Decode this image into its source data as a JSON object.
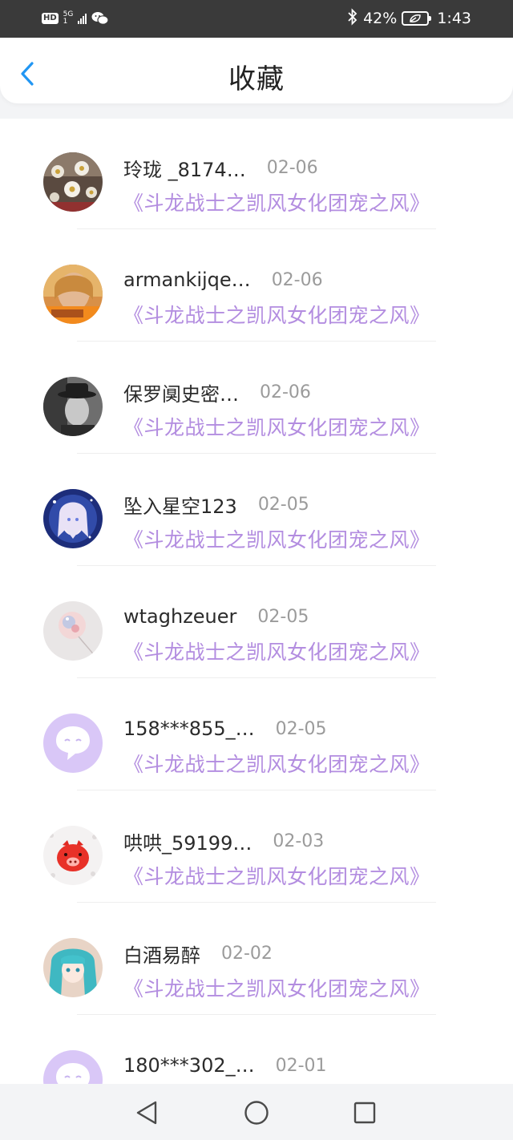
{
  "status_bar": {
    "hd": "HD",
    "network": "5G",
    "sim": "1",
    "battery_percent": "42%",
    "time": "1:43"
  },
  "header": {
    "title": "收藏"
  },
  "favorites": [
    {
      "user": "玲珑 _8174…",
      "date": "02-06",
      "work": "《斗龙战士之凯风女化团宠之风》",
      "avatar": "flowers"
    },
    {
      "user": "armankijqe…",
      "date": "02-06",
      "work": "《斗龙战士之凯风女化团宠之风》",
      "avatar": "girl-photo"
    },
    {
      "user": "保罗阒史密…",
      "date": "02-06",
      "work": "《斗龙战士之凯风女化团宠之风》",
      "avatar": "man-hat"
    },
    {
      "user": "坠入星空123",
      "date": "02-05",
      "work": "《斗龙战士之凯风女化团宠之风》",
      "avatar": "anime-girl-blue"
    },
    {
      "user": "wtaghzeuer",
      "date": "02-05",
      "work": "《斗龙战士之凯风女化团宠之风》",
      "avatar": "crystal-ball"
    },
    {
      "user": "158***855_…",
      "date": "02-05",
      "work": "《斗龙战士之凯风女化团宠之风》",
      "avatar": "default-chat"
    },
    {
      "user": "哄哄_59199…",
      "date": "02-03",
      "work": "《斗龙战士之凯风女化团宠之风》",
      "avatar": "red-pig"
    },
    {
      "user": "白酒易醉",
      "date": "02-02",
      "work": "《斗龙战士之凯风女化团宠之风》",
      "avatar": "miku"
    },
    {
      "user": "180***302_…",
      "date": "02-01",
      "work": "",
      "avatar": "default-chat"
    }
  ],
  "colors": {
    "accent": "#2196f3",
    "work_title": "#b38de0",
    "default_avatar": "#d9c7f7"
  }
}
